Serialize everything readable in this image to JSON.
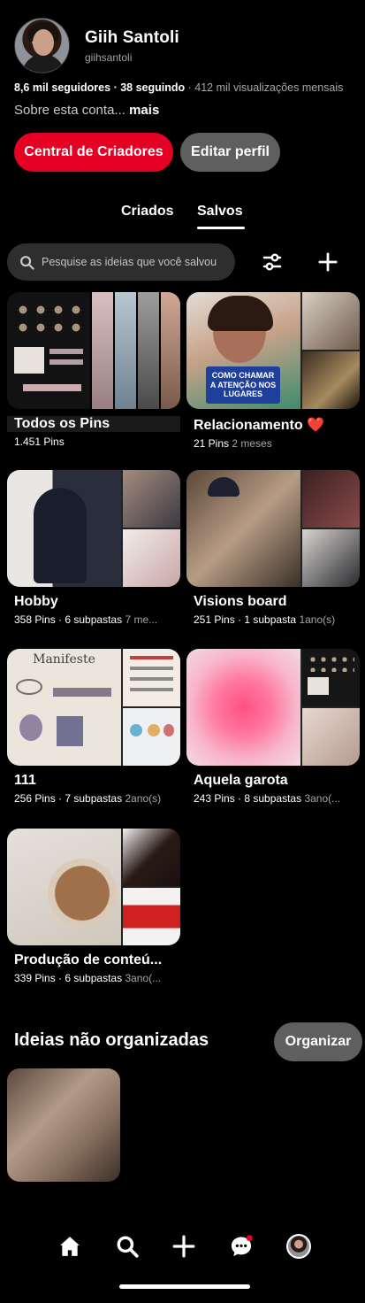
{
  "profile": {
    "name": "Giih Santoli",
    "handle": "giihsantoli",
    "followers": "8,6 mil seguidores",
    "following": "38 seguindo",
    "views": "412 mil visualizações mensais",
    "about": "Sobre esta conta...",
    "about_more": "mais"
  },
  "buttons": {
    "creators": "Central de Criadores",
    "edit": "Editar perfil"
  },
  "tabs": [
    "Criados",
    "Salvos"
  ],
  "active_tab": "Salvos",
  "search": {
    "placeholder": "Pesquise as ideias que você salvou"
  },
  "boards": [
    {
      "title": "Todos os Pins",
      "pins": "1.451 Pins",
      "sub": "",
      "age": ""
    },
    {
      "title": "Relacionamento ❤️",
      "pins": "21 Pins",
      "sub": "",
      "age": "2 meses"
    },
    {
      "title": "Hobby",
      "pins": "358 Pins",
      "sub": "6 subpastas",
      "age": "7 me..."
    },
    {
      "title": "Visions board",
      "pins": "251 Pins",
      "sub": "1 subpasta",
      "age": "1ano(s)"
    },
    {
      "title": "111",
      "pins": "256 Pins",
      "sub": "7 subpastas",
      "age": "2ano(s)"
    },
    {
      "title": "Aquela garota",
      "pins": "243 Pins",
      "sub": "8 subpastas",
      "age": "3ano(..."
    },
    {
      "title": "Produção de conteú...",
      "pins": "339 Pins",
      "sub": "6 subpastas",
      "age": "3ano(..."
    }
  ],
  "thumb_text": {
    "rel_caption": "COMO CHAMAR A ATENÇÃO NOS LUGARES",
    "manifest": "Manifeste"
  },
  "unorganized": {
    "title": "Ideias não organizadas",
    "button": "Organizar"
  },
  "nav": [
    "home-icon",
    "search-icon",
    "plus-icon",
    "messages-icon",
    "profile-avatar"
  ],
  "colors": {
    "accent": "#e60023",
    "secondary_button": "#5f5f5f",
    "background": "#000000"
  }
}
